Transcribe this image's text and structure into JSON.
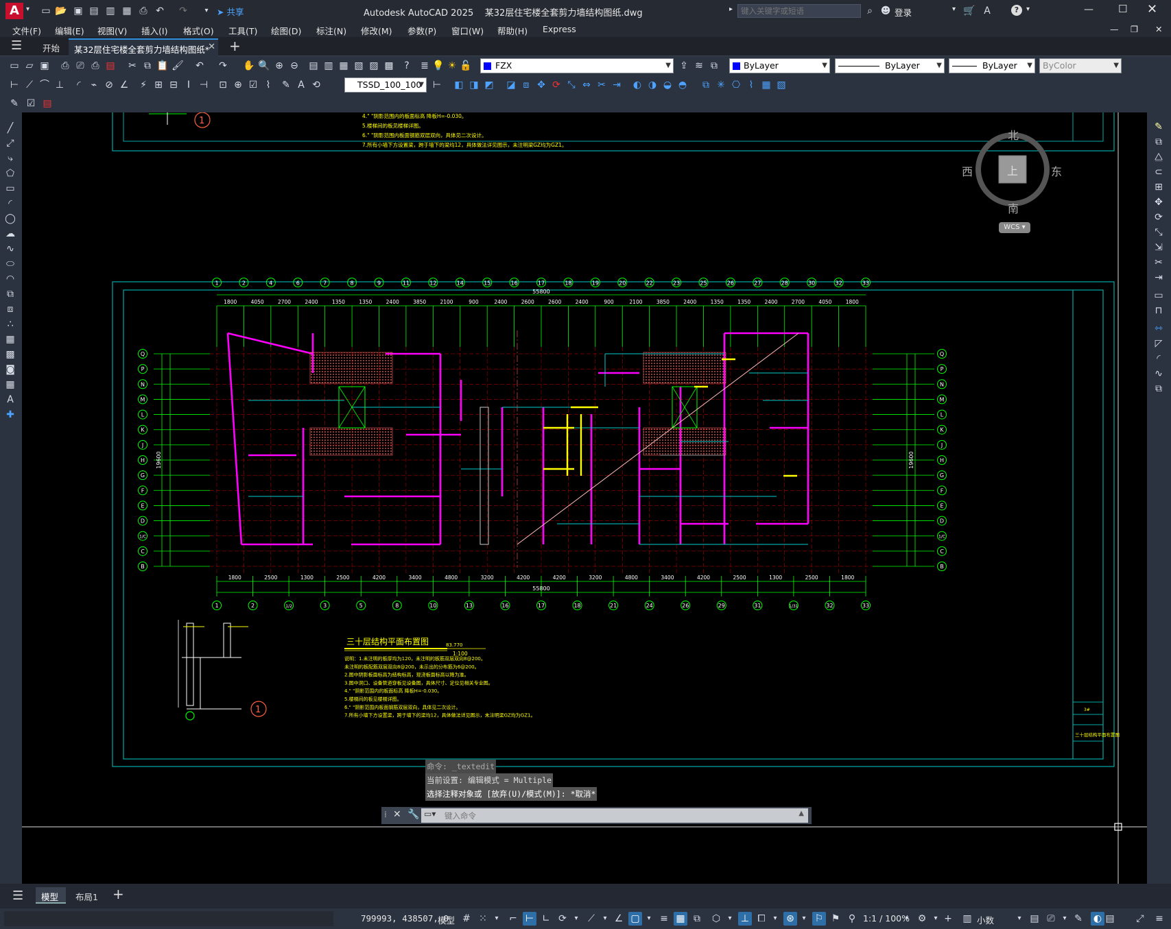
{
  "app": {
    "logo_letter": "A",
    "title": "Autodesk AutoCAD 2025    某32层住宅楼全套剪力墙结构图纸.dwg",
    "share_label": "共享",
    "search_placeholder": "键入关键字或短语",
    "login_label": "登录",
    "accent": "#c8102e"
  },
  "menu": [
    "文件(F)",
    "编辑(E)",
    "视图(V)",
    "插入(I)",
    "格式(O)",
    "工具(T)",
    "绘图(D)",
    "标注(N)",
    "修改(M)",
    "参数(P)",
    "窗口(W)",
    "帮助(H)",
    "Express"
  ],
  "tabs": {
    "start_label": "开始",
    "doc_label": "某32层住宅楼全套剪力墙结构图纸*"
  },
  "toolbar": {
    "layer_value": "FZX",
    "dimstyle_value": "TSSD_100_100",
    "color_value": "ByLayer",
    "linetype_value": "ByLayer",
    "lineweight_value": "ByLayer",
    "plotstyle_value": "ByColor"
  },
  "viewcube": {
    "north": "北",
    "south": "南",
    "east": "东",
    "west": "西",
    "top": "上",
    "wcs": "WCS"
  },
  "drawing": {
    "title": "三十层结构平面布置图",
    "elevation": "83.770",
    "scale": "1:100",
    "detail_mark": "1",
    "total_dim": "55800",
    "vertical_total": "19600",
    "title_block_sheet": "三十层结构平面布置图",
    "top_axes": [
      "1",
      "2",
      "4",
      "6",
      "7",
      "8",
      "9",
      "11",
      "12",
      "14",
      "15",
      "16",
      "17",
      "18",
      "19",
      "20",
      "22",
      "23",
      "25",
      "26",
      "27",
      "28",
      "30",
      "32",
      "33"
    ],
    "top_dims": [
      "1800",
      "4050",
      "2700",
      "2400",
      "1350",
      "1350",
      "2400",
      "3850",
      "2100",
      "900",
      "2400",
      "2600",
      "2600",
      "2400",
      "900",
      "2100",
      "3850",
      "2400",
      "1350",
      "1350",
      "2400",
      "2700",
      "4050",
      "1800"
    ],
    "bottom_axes": [
      "1",
      "2",
      "1/2",
      "3",
      "5",
      "8",
      "10",
      "13",
      "16",
      "17",
      "18",
      "21",
      "24",
      "26",
      "29",
      "31",
      "1/31",
      "32",
      "33"
    ],
    "bottom_dims": [
      "1800",
      "2500",
      "1300",
      "2500",
      "4200",
      "3400",
      "4800",
      "3200",
      "4200",
      "4200",
      "3200",
      "4800",
      "3400",
      "4200",
      "2500",
      "1300",
      "2500",
      "1800"
    ],
    "row_axes": [
      "Q",
      "P",
      "N",
      "M",
      "L",
      "K",
      "J",
      "H",
      "G",
      "F",
      "E",
      "D",
      "1/C",
      "C",
      "B"
    ],
    "notes": [
      "说明：1.未注明的板厚均为120，未注明的板筋双层双向8@200。",
      "未注明的板配筋双层双向8@200，未示出的分布筋为6@200。",
      "2.图中阴影板面标高为结构标高，现浇板面标高以降为准。",
      "3.图中洞口、设备管道穿板见设备图，具体尺寸、定位见相关专业图。",
      "4.\"  \"阴影范围内的板面标高 降板H=-0.030。",
      "5.楼梯间的板见楼梯详图。",
      "6.\"  \"阴影范围内板面钢筋双层双向，具体见二次设计。",
      "7.所有小墙下方设置梁，跨于墙下的梁均12，具体做法详见图示，未注明梁GZ均为GZ1。"
    ]
  },
  "command": {
    "line1": "命令: _textedit",
    "line2": "当前设置: 编辑模式 = Multiple",
    "line3": "选择注释对象或 [放弃(U)/模式(M)]: *取消*",
    "placeholder": "键入命令"
  },
  "layout_tabs": [
    "模型",
    "布局1"
  ],
  "status": {
    "coords": "799993, 438507, 0",
    "model_label": "模型",
    "scale": "1:1 / 100%",
    "units": "小数"
  }
}
